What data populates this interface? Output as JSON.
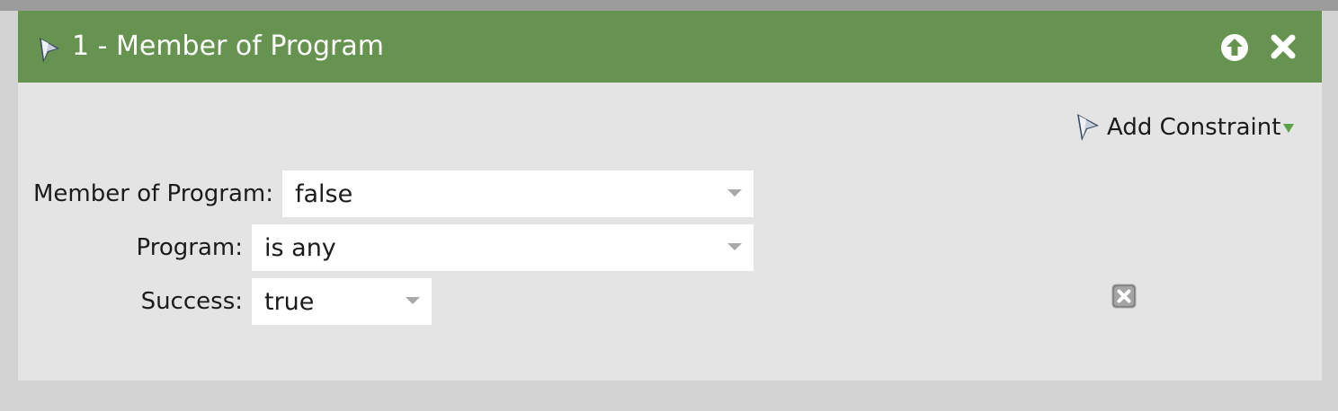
{
  "panel": {
    "title": "1 - Member of Program",
    "header_color": "#679350",
    "icons": {
      "filter": "filter-funnel-icon",
      "move_up": "arrow-up-circle-icon",
      "remove": "close-icon"
    }
  },
  "add_constraint": {
    "label": "Add Constraint",
    "icon": "filter-funnel-icon",
    "menu_icon": "triangle-down-icon",
    "accent_color": "#5aa244"
  },
  "constraints": [
    {
      "label": "Member of Program:",
      "value": "false"
    },
    {
      "label": "Program:",
      "value": "is any"
    },
    {
      "label": "Success:",
      "value": "true"
    }
  ],
  "remove_constraint_icon": "close-box-icon"
}
